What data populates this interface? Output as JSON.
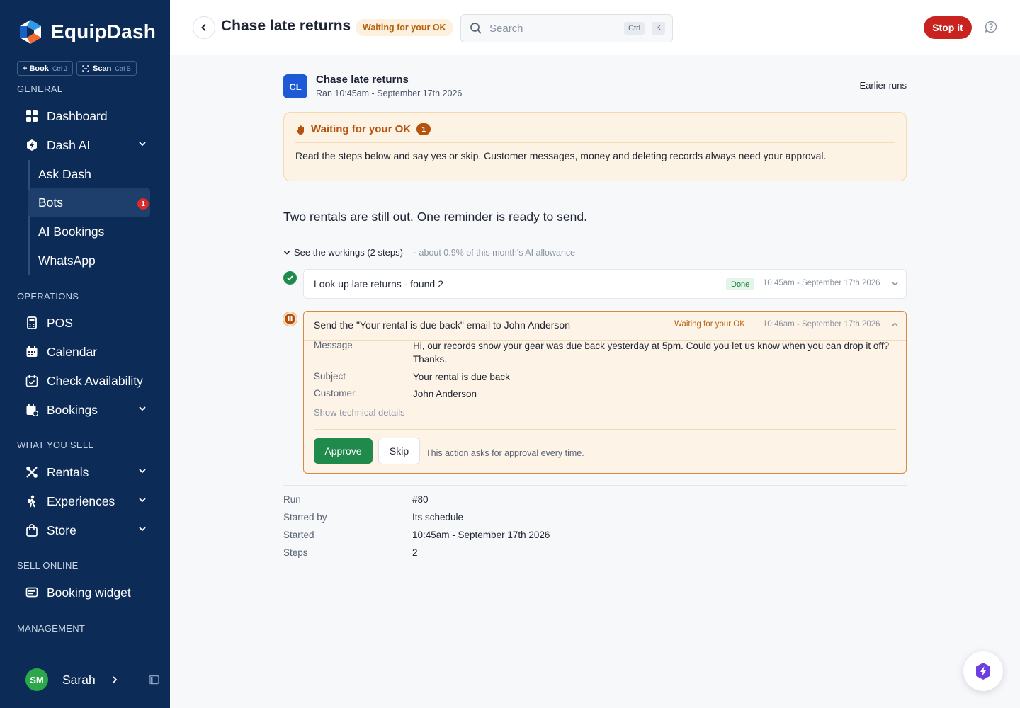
{
  "app": {
    "name": "EquipDash"
  },
  "quick_actions": [
    {
      "label": "+ Book",
      "shortcut": "Ctrl J"
    },
    {
      "label": "Scan",
      "shortcut": "Ctrl B"
    }
  ],
  "sidebar": {
    "sections": {
      "general": "GENERAL",
      "operations": "OPERATIONS",
      "what_you_sell": "WHAT YOU SELL",
      "sell_online": "SELL ONLINE",
      "management": "MANAGEMENT"
    },
    "items": {
      "dashboard": "Dashboard",
      "dash_ai": "Dash AI",
      "ask_dash": "Ask Dash",
      "bots": "Bots",
      "bots_badge": "1",
      "ai_bookings": "AI Bookings",
      "whatsapp": "WhatsApp",
      "pos": "POS",
      "calendar": "Calendar",
      "check_availability": "Check Availability",
      "bookings": "Bookings",
      "rentals": "Rentals",
      "experiences": "Experiences",
      "store": "Store",
      "booking_widget": "Booking widget"
    },
    "user": {
      "initials": "SM",
      "name": "Sarah"
    }
  },
  "header": {
    "title": "Chase late returns",
    "status": "Waiting for your OK",
    "search_placeholder": "Search",
    "search_kbd": [
      "Ctrl",
      "K"
    ],
    "stop_label": "Stop it"
  },
  "bot": {
    "initials": "CL",
    "title": "Chase late returns",
    "subtitle": "Ran 10:45am - September 17th 2026",
    "earlier_runs": "Earlier runs"
  },
  "alert": {
    "title": "Waiting for your OK",
    "count": "1",
    "body": "Read the steps below and say yes or skip. Customer messages, money and deleting records always need your approval."
  },
  "summary": "Two rentals are still out. One reminder is ready to send.",
  "workings": {
    "label": "See the workings (2 steps)",
    "allowance": "· about 0.9% of this month's AI allowance"
  },
  "steps": [
    {
      "title": "Look up late returns - found 2",
      "status": "Done",
      "time": "10:45am - September 17th 2026"
    },
    {
      "title": "Send the \"Your rental is due back\" email to John Anderson",
      "status": "Waiting for your OK",
      "time": "10:46am - September 17th 2026",
      "fields": [
        {
          "key": "Message",
          "value": "Hi, our records show your gear was due back yesterday at 5pm. Could you let us know when you can drop it off? Thanks."
        },
        {
          "key": "Subject",
          "value": "Your rental is due back"
        },
        {
          "key": "Customer",
          "value": "John Anderson"
        }
      ],
      "technical": "Show technical details",
      "approve": "Approve",
      "skip": "Skip",
      "note": "This action asks for approval every time."
    }
  ],
  "run_meta": [
    {
      "key": "Run",
      "value": "#80"
    },
    {
      "key": "Started by",
      "value": "Its schedule"
    },
    {
      "key": "Started",
      "value": "10:45am - September 17th 2026"
    },
    {
      "key": "Steps",
      "value": "2"
    }
  ],
  "colors": {
    "sidebar_bg": "#0c2c57",
    "accent_orange": "#b5520e",
    "approve_green": "#1f8a4c",
    "stop_red": "#c8231f",
    "brand_blue": "#1d5bd6"
  }
}
